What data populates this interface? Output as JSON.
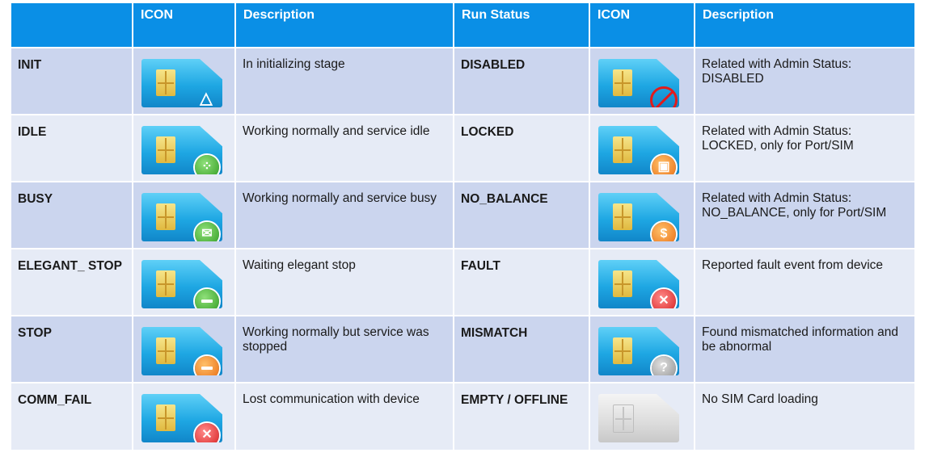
{
  "header": {
    "status_label": "",
    "icon_label": "ICON",
    "description_label": "Description",
    "run_status_label": "Run Status",
    "icon2_label": "ICON",
    "description2_label": "Description"
  },
  "rows": [
    {
      "left": {
        "status": "INIT",
        "icon": "sim-card-warning-icon",
        "description": "In initializing stage"
      },
      "right": {
        "status": "DISABLED",
        "icon": "sim-card-disabled-icon",
        "description": "Related with Admin Status: DISABLED"
      }
    },
    {
      "left": {
        "status": "IDLE",
        "icon": "sim-card-idle-icon",
        "description": "Working normally and service idle"
      },
      "right": {
        "status": "LOCKED",
        "icon": "sim-card-locked-icon",
        "description": "Related with Admin Status: LOCKED, only for Port/SIM"
      }
    },
    {
      "left": {
        "status": "BUSY",
        "icon": "sim-card-busy-icon",
        "description": "Working normally and service busy"
      },
      "right": {
        "status": "NO_BALANCE",
        "icon": "sim-card-no-balance-icon",
        "description": "Related with Admin Status: NO_BALANCE, only for Port/SIM"
      }
    },
    {
      "left": {
        "status": "ELEGANT_ STOP",
        "icon": "sim-card-elegant-stop-icon",
        "description": "Waiting elegant stop"
      },
      "right": {
        "status": "FAULT",
        "icon": "sim-card-fault-icon",
        "description": "Reported fault event from device"
      }
    },
    {
      "left": {
        "status": "STOP",
        "icon": "sim-card-stop-icon",
        "description": "Working normally but service was stopped"
      },
      "right": {
        "status": "MISMATCH",
        "icon": "sim-card-mismatch-icon",
        "description": "Found mismatched information and be abnormal"
      }
    },
    {
      "left": {
        "status": "COMM_FAIL",
        "icon": "sim-card-comm-fail-icon",
        "description": "Lost communication with device"
      },
      "right": {
        "status": "EMPTY / OFFLINE",
        "icon": "sim-card-empty-icon",
        "description": "No SIM Card loading"
      }
    }
  ],
  "colors": {
    "header": "#0a8fe6",
    "row_dark": "#cbd5ee",
    "row_light": "#e6ebf6",
    "sim_card": "#1ea7e3",
    "chip": "#e0b93f"
  }
}
